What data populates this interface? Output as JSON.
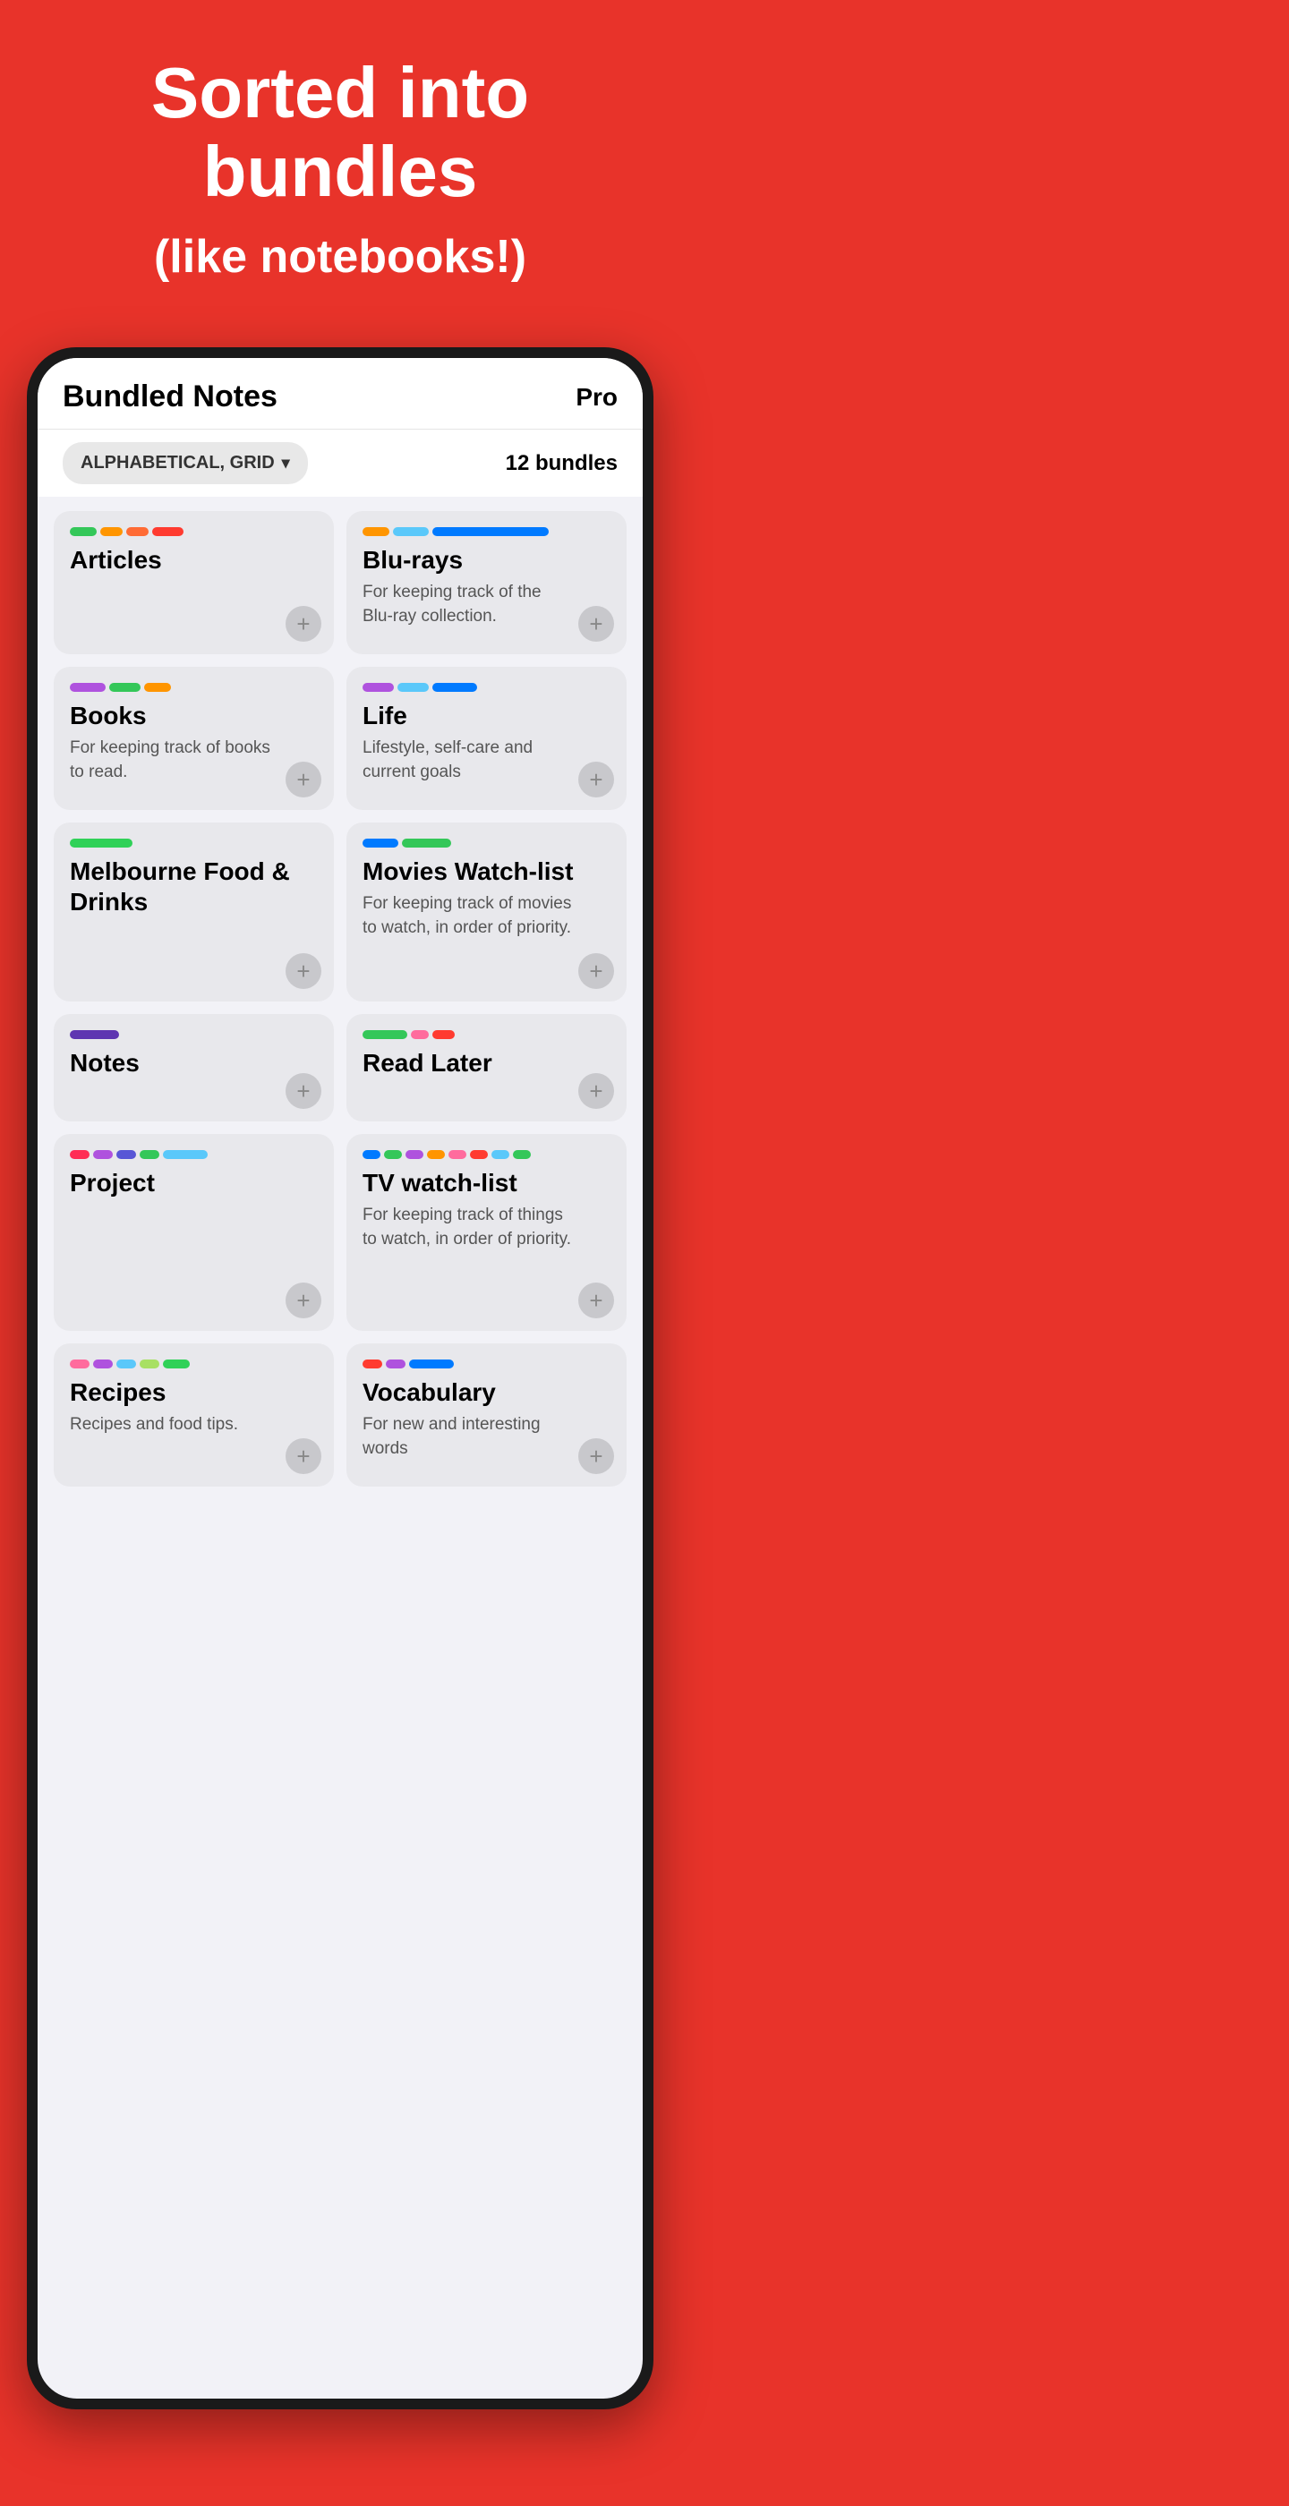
{
  "hero": {
    "title": "Sorted into bundles",
    "subtitle": "(like notebooks!)"
  },
  "app": {
    "title": "Bundled Notes",
    "pro_label": "Pro",
    "sort_label": "ALPHABETICAL, GRID",
    "bundles_count": "12 bundles"
  },
  "bundles": [
    {
      "id": "articles",
      "name": "Articles",
      "desc": "",
      "color_class": "articles-bar",
      "segments": 4
    },
    {
      "id": "blurays",
      "name": "Blu-rays",
      "desc": "For keeping track of the Blu-ray collection.",
      "color_class": "blurays-bar",
      "segments": 3
    },
    {
      "id": "books",
      "name": "Books",
      "desc": "For keeping track of books to read.",
      "color_class": "books-bar",
      "segments": 3
    },
    {
      "id": "life",
      "name": "Life",
      "desc": "Lifestyle, self-care and current goals",
      "color_class": "life-bar",
      "segments": 3
    },
    {
      "id": "melbourne",
      "name": "Melbourne Food & Drinks",
      "desc": "",
      "color_class": "melbourne-bar",
      "segments": 1
    },
    {
      "id": "movies",
      "name": "Movies Watch-list",
      "desc": "For keeping track of movies to watch, in order of priority.",
      "color_class": "movies-bar",
      "segments": 2
    },
    {
      "id": "notes",
      "name": "Notes",
      "desc": "",
      "color_class": "notes-bar",
      "segments": 1
    },
    {
      "id": "readlater",
      "name": "Read Later",
      "desc": "",
      "color_class": "readlater-bar",
      "segments": 3
    },
    {
      "id": "project",
      "name": "Project",
      "desc": "",
      "color_class": "project-bar",
      "segments": 5
    },
    {
      "id": "tv",
      "name": "TV watch-list",
      "desc": "For keeping track of things to watch, in order of priority.",
      "color_class": "tv-bar",
      "segments": 8
    },
    {
      "id": "recipes",
      "name": "Recipes",
      "desc": "Recipes and food tips.",
      "color_class": "recipes-bar",
      "segments": 5
    },
    {
      "id": "vocabulary",
      "name": "Vocabulary",
      "desc": "For new and interesting words",
      "color_class": "vocab-bar",
      "segments": 3
    }
  ],
  "add_icon": "+"
}
